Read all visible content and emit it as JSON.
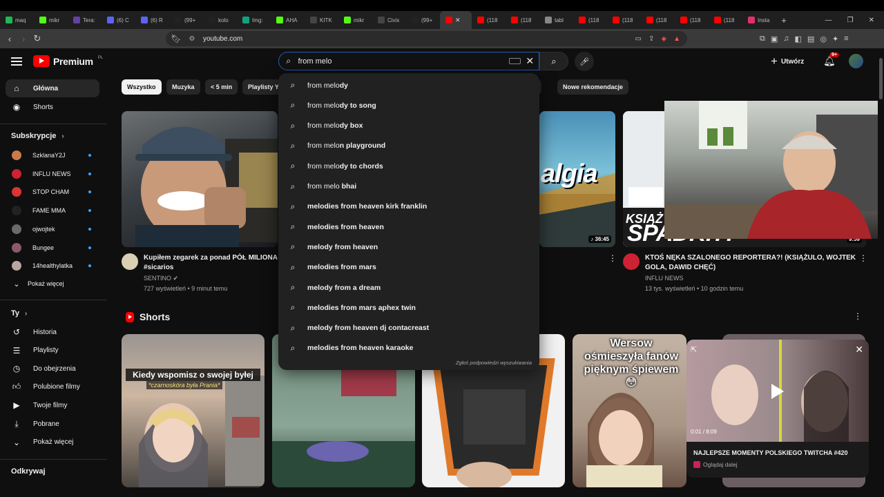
{
  "browser": {
    "tabs": [
      {
        "label": "maq",
        "color": "#1db954"
      },
      {
        "label": "mikr",
        "color": "#53fc18"
      },
      {
        "label": "Tera:",
        "color": "#6441a5"
      },
      {
        "label": "(6) C",
        "color": "#5865f2"
      },
      {
        "label": "(6) R",
        "color": "#5865f2"
      },
      {
        "label": "(99+",
        "color": "#222222"
      },
      {
        "label": "kolo",
        "color": "#222222"
      },
      {
        "label": "Img:",
        "color": "#10a37f"
      },
      {
        "label": "AHA",
        "color": "#53fc18"
      },
      {
        "label": "KITK",
        "color": "#444444"
      },
      {
        "label": "mikr",
        "color": "#53fc18"
      },
      {
        "label": "Civix",
        "color": "#444444"
      },
      {
        "label": "(99+",
        "color": "#222222"
      },
      {
        "label": "(118",
        "color": "#ff0000"
      },
      {
        "label": "(118",
        "color": "#ff0000"
      },
      {
        "label": "tabl",
        "color": "#888888"
      },
      {
        "label": "(118",
        "color": "#ff0000"
      },
      {
        "label": "(118",
        "color": "#ff0000"
      },
      {
        "label": "(118",
        "color": "#ff0000"
      },
      {
        "label": "(118",
        "color": "#ff0000"
      },
      {
        "label": "(118",
        "color": "#ff0000"
      },
      {
        "label": "Insta",
        "color": "#e1306c"
      }
    ],
    "active_tab_color": "#ff0000",
    "url": "youtube.com"
  },
  "header": {
    "logo_text": "Premium",
    "country_code": "PL",
    "search_value": "from melo",
    "create_label": "Utwórz",
    "notif_badge": "9+"
  },
  "sidebar": {
    "main": [
      {
        "label": "Główna",
        "icon": "home-icon"
      },
      {
        "label": "Shorts",
        "icon": "shorts-icon"
      }
    ],
    "subs_heading": "Subskrypcje",
    "subs": [
      {
        "label": "SzklanaY2J",
        "color": "#c97a4a"
      },
      {
        "label": "INFLU NEWS",
        "color": "#cc2233"
      },
      {
        "label": "STOP CHAM",
        "color": "#dd3333"
      },
      {
        "label": "FAME MMA",
        "color": "#222222"
      },
      {
        "label": "ojwojtek",
        "color": "#6a6a6a"
      },
      {
        "label": "Bungee",
        "color": "#8a5a6a"
      },
      {
        "label": "14healthylatka",
        "color": "#b8a6a0"
      }
    ],
    "show_more": "Pokaż więcej",
    "you_heading": "Ty",
    "you": [
      {
        "label": "Historia",
        "icon": "history-icon"
      },
      {
        "label": "Playlisty",
        "icon": "playlist-icon"
      },
      {
        "label": "Do obejrzenia",
        "icon": "watch-later-icon"
      },
      {
        "label": "Polubione filmy",
        "icon": "like-icon"
      },
      {
        "label": "Twoje filmy",
        "icon": "your-videos-icon"
      },
      {
        "label": "Pobrane",
        "icon": "download-icon"
      },
      {
        "label": "Pokaż więcej",
        "icon": "chevron-down-icon"
      }
    ],
    "explore_heading": "Odkrywaj"
  },
  "chips": [
    "Wszystko",
    "Muzyka",
    "< 5 min",
    "Playlisty Y",
    "ne",
    "Nowe rekomendacje"
  ],
  "suggestions": {
    "typed": "from melo",
    "items": [
      {
        "typed": "from melo",
        "rest": "dy"
      },
      {
        "typed": "from melo",
        "rest": "dy to song"
      },
      {
        "typed": "from melo",
        "rest": "dy box"
      },
      {
        "typed": "from melo",
        "rest": "n playground"
      },
      {
        "typed": "from melo",
        "rest": "dy to chords"
      },
      {
        "typed": "from melo",
        "rest": " bhai"
      },
      {
        "typed": "",
        "rest": "melodies from heaven kirk franklin"
      },
      {
        "typed": "",
        "rest": "melodies from heaven"
      },
      {
        "typed": "",
        "rest": "melody from heaven"
      },
      {
        "typed": "",
        "rest": "melodies from mars"
      },
      {
        "typed": "",
        "rest": "melody from a dream"
      },
      {
        "typed": "",
        "rest": "melodies from mars aphex twin"
      },
      {
        "typed": "",
        "rest": "melody from heaven dj contacreast"
      },
      {
        "typed": "",
        "rest": "melodies from heaven karaoke"
      }
    ],
    "report": "Zgłoś podpowiedzi wyszukiwania"
  },
  "videos": [
    {
      "title1": "Kupiłem zegarek za ponad PÓŁ MILIONA",
      "title2": "#sicarios",
      "channel": "SENTINO",
      "meta": "727 wyświetleń • 9 minut temu"
    },
    {
      "duration": "36:45",
      "overlay": "algia"
    },
    {
      "title1": "KTOŚ NĘKA SZALONEGO REPORTERA?! (KSIĄŻULO, WOJTEK",
      "title2": "GOLA, DAWID CHĘĆ)",
      "channel": "INFLU NEWS",
      "meta": "13 tys. wyświetleń • 10 godzin temu",
      "duration": "9:59",
      "overlay": "SPADKI?!",
      "overlay2": "KSIĄŻ"
    }
  ],
  "shorts": {
    "heading": "Shorts",
    "items": [
      {
        "caption": "Kiedy wspomisz o swojej byłej",
        "sub": "*czarnoskóra była Prania*"
      },
      {
        "caption": ""
      },
      {
        "caption": ""
      },
      {
        "caption": "Wersow ośmieszyła fanów pięknym śpiewem 😳"
      }
    ]
  },
  "miniplayer": {
    "time": "0:01 / 8:09",
    "title": "NAJLEPSZE MOMENTY POLSKIEGO TWITCHA #420",
    "channel": "Oglądaj dalej"
  }
}
